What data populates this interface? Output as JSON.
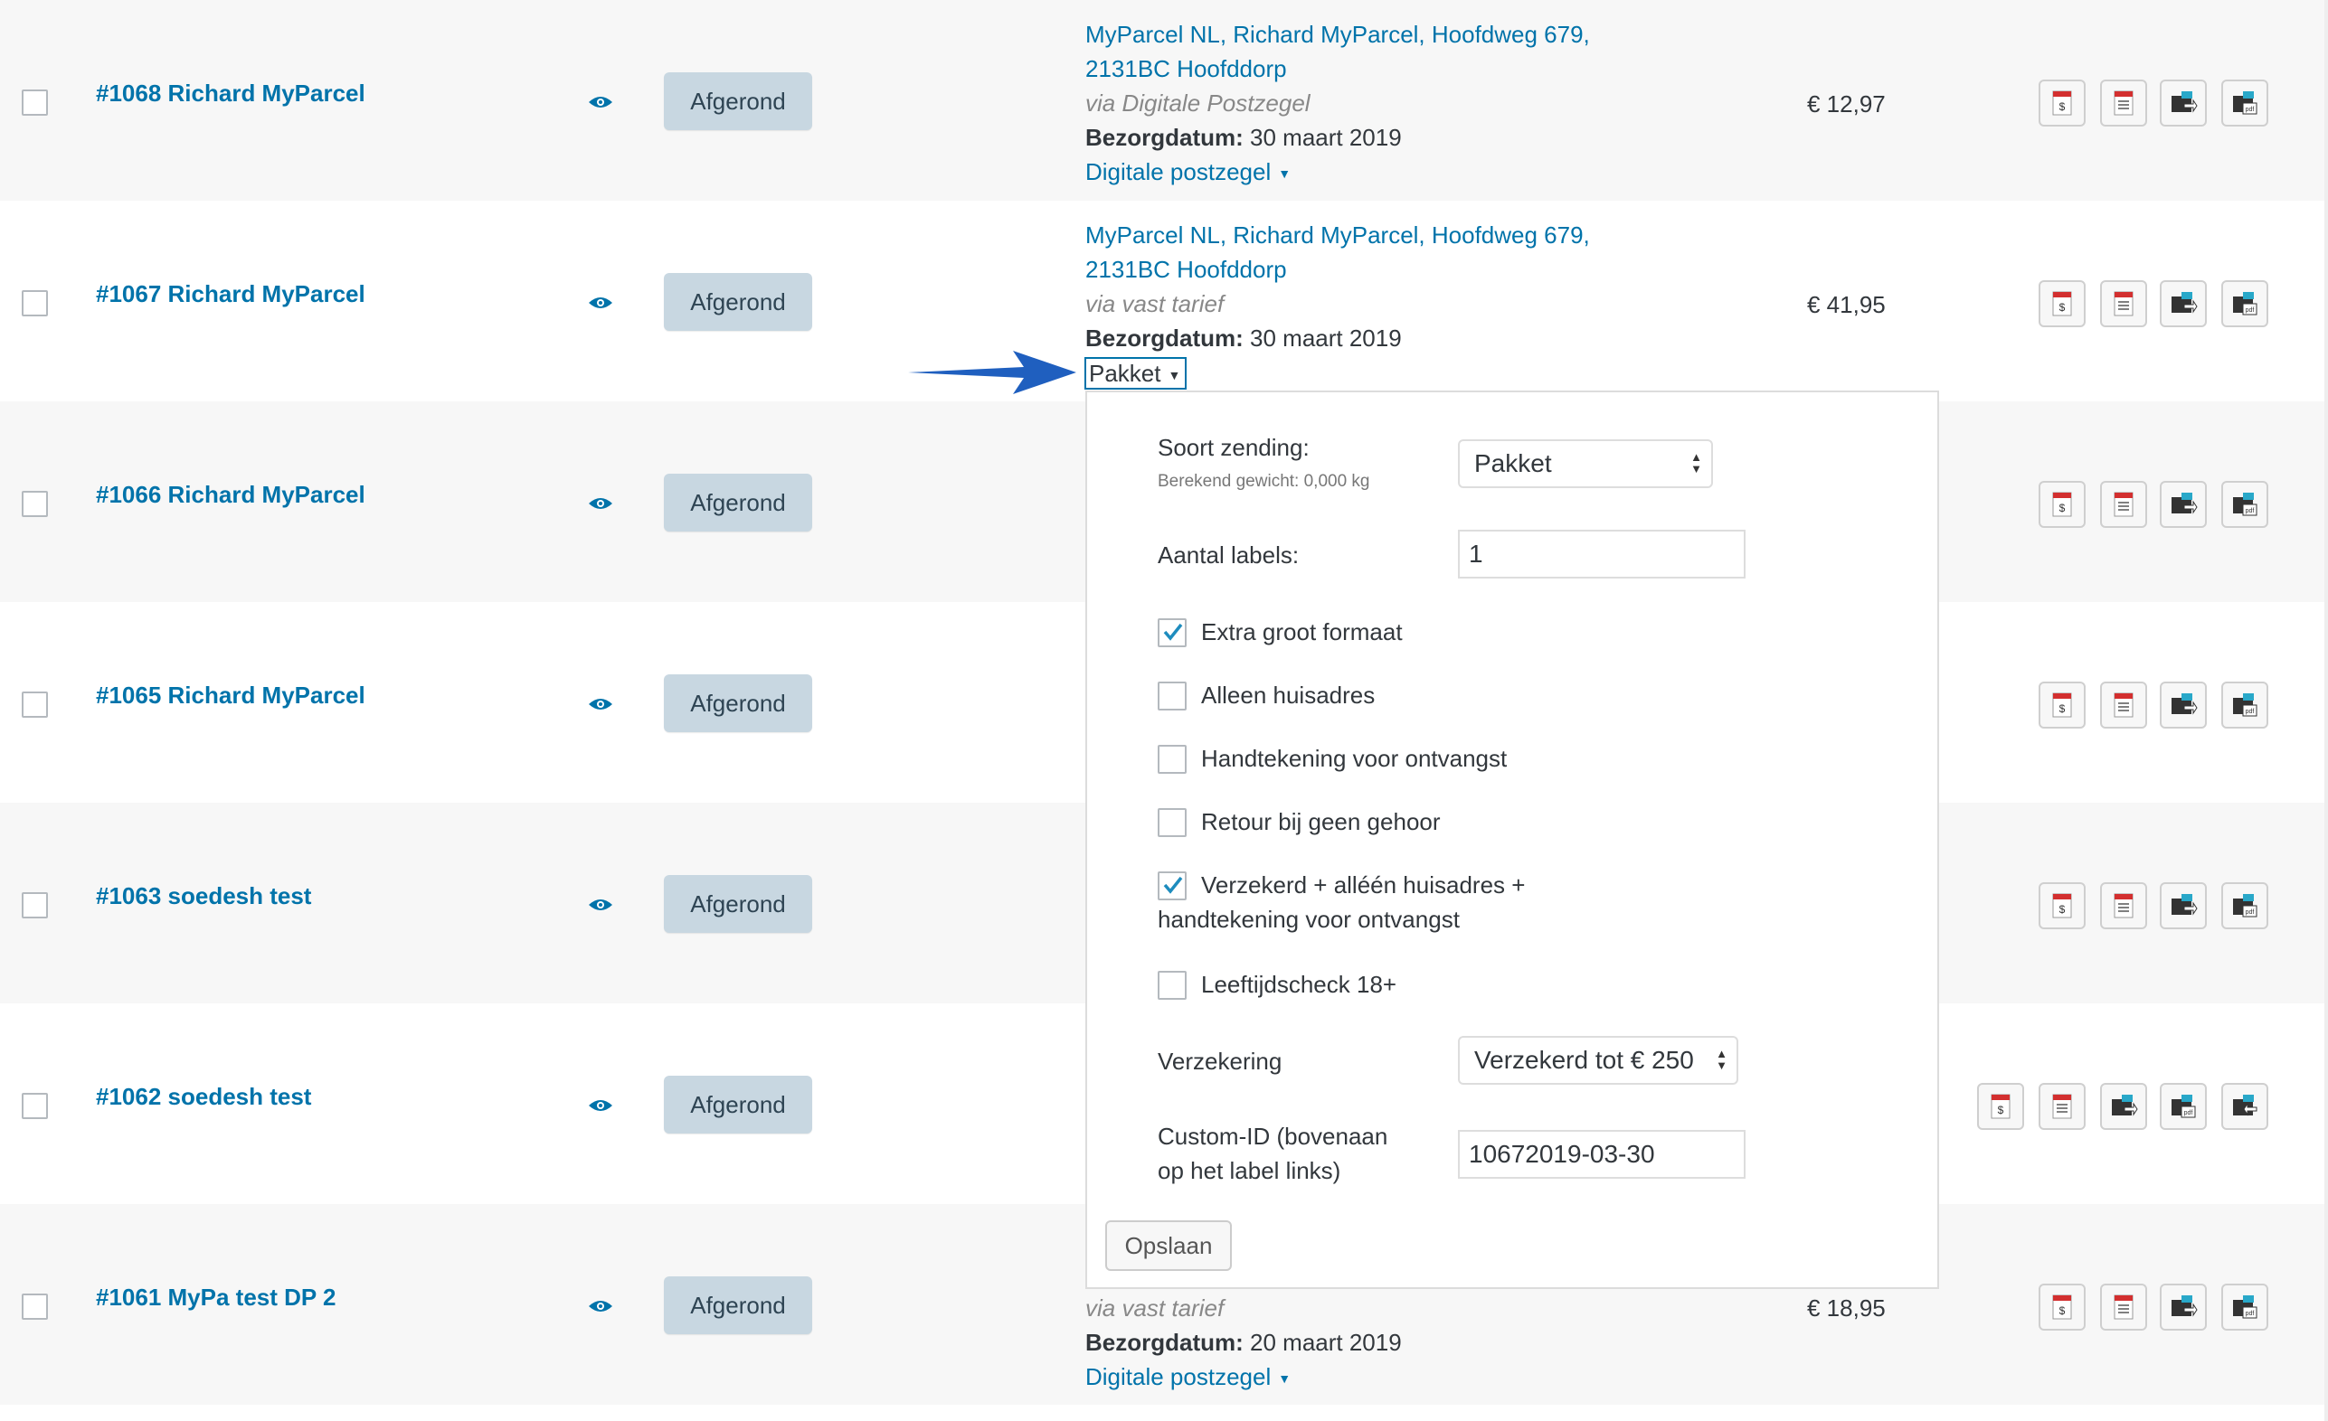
{
  "orders": [
    {
      "id": "#1068 Richard MyParcel",
      "status": "Afgerond",
      "address1": "MyParcel NL, Richard MyParcel, Hoofdweg 679,",
      "address2": "2131BC Hoofddorp",
      "via": "via Digitale Postzegel",
      "delivery_label": "Bezorgdatum:",
      "delivery_date": "30 maart 2019",
      "shipment_type": "Digitale postzegel",
      "total": "€ 12,97"
    },
    {
      "id": "#1067 Richard MyParcel",
      "status": "Afgerond",
      "address1": "MyParcel NL, Richard MyParcel, Hoofdweg 679,",
      "address2": "2131BC Hoofddorp",
      "via": "via vast tarief",
      "delivery_label": "Bezorgdatum:",
      "delivery_date": "30 maart 2019",
      "shipment_type": "Pakket",
      "total": "€ 41,95"
    },
    {
      "id": "#1066 Richard MyParcel",
      "status": "Afgerond"
    },
    {
      "id": "#1065 Richard MyParcel",
      "status": "Afgerond"
    },
    {
      "id": "#1063 soedesh test",
      "status": "Afgerond"
    },
    {
      "id": "#1062 soedesh test",
      "status": "Afgerond"
    },
    {
      "id": "#1061 MyPa test DP 2",
      "status": "Afgerond",
      "via": "via vast tarief",
      "delivery_label": "Bezorgdatum:",
      "delivery_date": "20 maart 2019",
      "shipment_type": "Digitale postzegel",
      "total": "€ 18,95"
    }
  ],
  "popup": {
    "shipment_type_label": "Soort zending:",
    "weight_note": "Berekend gewicht: 0,000 kg",
    "shipment_type_value": "Pakket",
    "labels_count_label": "Aantal labels:",
    "labels_count_value": "1",
    "options": [
      {
        "label": "Extra groot formaat",
        "checked": true
      },
      {
        "label": "Alleen huisadres",
        "checked": false
      },
      {
        "label": "Handtekening voor ontvangst",
        "checked": false
      },
      {
        "label": "Retour bij geen gehoor",
        "checked": false
      },
      {
        "label_line1": "Verzekerd + alléén huisadres +",
        "label_line2": "handtekening voor ontvangst",
        "checked": true
      },
      {
        "label": "Leeftijdscheck 18+",
        "checked": false
      }
    ],
    "insurance_label": "Verzekering",
    "insurance_value": "Verzekerd tot € 250",
    "custom_id_label_line1": "Custom-ID (bovenaan",
    "custom_id_label_line2": "op het label links)",
    "custom_id_value": "10672019-03-30",
    "save_label": "Opslaan"
  },
  "icons": [
    "pdf-invoice-icon",
    "pdf-packing-slip-icon",
    "export-label-icon",
    "pdf-label-icon",
    "return-label-icon"
  ],
  "colors": {
    "link": "#0073aa",
    "status_bg": "#c8d7e1",
    "arrow": "#1f5fbf",
    "row_alt": "#f7f7f7"
  }
}
